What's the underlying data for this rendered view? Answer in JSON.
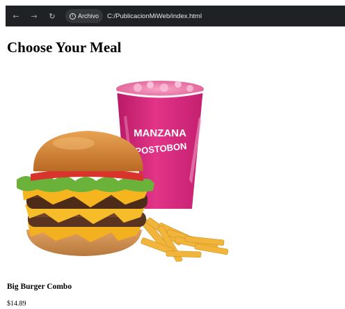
{
  "browser": {
    "back_icon": "arrow-left-icon",
    "forward_icon": "arrow-right-icon",
    "reload_icon": "reload-icon",
    "site_chip_label": "Archivo",
    "url": "C:/PublicacionMiWeb/index.html"
  },
  "page": {
    "title": "Choose Your Meal"
  },
  "product": {
    "image_alt": "Big Burger Combo",
    "cup_text_line1": "MANZANA",
    "cup_text_line2": "POSTOBON",
    "name": "Big Burger Combo",
    "price": "$14.89"
  },
  "colors": {
    "chrome_bg": "#202124",
    "cup_pink": "#d6247a",
    "bun": "#d98a3a",
    "fries": "#f0b53a"
  }
}
